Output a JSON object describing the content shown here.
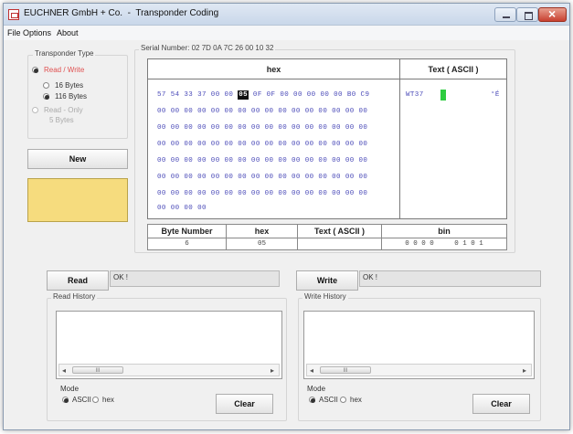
{
  "window": {
    "title": "EUCHNER GmbH + Co.  -  Transponder Coding"
  },
  "menu": {
    "items": [
      "File",
      "Options",
      "About"
    ]
  },
  "transponder_type": {
    "group_label": "Transponder Type",
    "read_write_label": "Read / Write",
    "opt_16_label": "16 Bytes",
    "opt_116_label": "116 Bytes",
    "read_only_label": "Read - Only",
    "read_only_sub_label": "5 Bytes",
    "selected": "Read / Write",
    "selected_size": "116 Bytes"
  },
  "new_button_label": "New",
  "status_color": "#f6dc7e",
  "serial": {
    "label": "Serial Number: 02 7D 0A 7C 26 00 10 32"
  },
  "hex_view": {
    "hex_header": "hex",
    "text_header": "Text ( ASCII )",
    "rows": [
      "57 54 33 37 00 00 05 0F 0F 00 00 00 00 00 B0 C9",
      "00 00 00 00 00 00 00 00 00 00 00 00 00 00 00 00",
      "00 00 00 00 00 00 00 00 00 00 00 00 00 00 00 00",
      "00 00 00 00 00 00 00 00 00 00 00 00 00 00 00 00",
      "00 00 00 00 00 00 00 00 00 00 00 00 00 00 00 00",
      "00 00 00 00 00 00 00 00 00 00 00 00 00 00 00 00",
      "00 00 00 00 00 00 00 00 00 00 00 00 00 00 00 00",
      "00 00 00 00"
    ],
    "selected_byte": "05",
    "ascii_prefix": "WT37",
    "ascii_suffix": "°É",
    "cursor_color": "#2ecc40"
  },
  "byte_info": {
    "byte_number_header": "Byte Number",
    "hex_header": "hex",
    "text_header": "Text ( ASCII )",
    "bin_header": "bin",
    "byte_number": "6",
    "hex": "05",
    "text": "",
    "bin": "0 0 0 0     0 1 0 1"
  },
  "read": {
    "button_label": "Read",
    "status": "OK !",
    "history_label": "Read History",
    "mode_label": "Mode",
    "mode_ascii": "ASCII",
    "mode_hex": "hex",
    "selected_mode": "ASCII",
    "clear_label": "Clear"
  },
  "write": {
    "button_label": "Write",
    "status": "OK !",
    "history_label": "Write History",
    "mode_label": "Mode",
    "mode_ascii": "ASCII",
    "mode_hex": "hex",
    "selected_mode": "ASCII",
    "clear_label": "Clear"
  },
  "scroll_thumb_glyph": "III"
}
